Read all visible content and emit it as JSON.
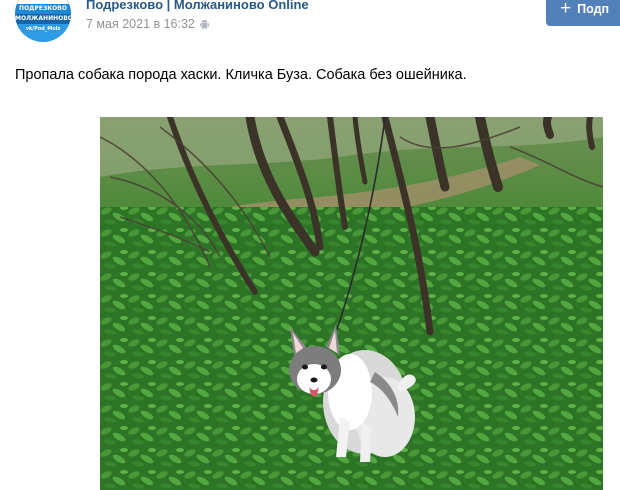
{
  "group": {
    "name": "Подрезково | Молжаниново Online",
    "avatar_lines": [
      "ПОДРЕЗКОВО",
      "МОЛЖАНИНОВО",
      "vk/Pod_Molz"
    ]
  },
  "post": {
    "date": "7 мая 2021 в 16:32",
    "platform_icon": "android-icon",
    "text": "Пропала собака порода хаски. Кличка Буза. Собака без ошейника."
  },
  "subscribe": {
    "label": "Подп",
    "icon": "plus-icon",
    "color": "#5181b8"
  },
  "colors": {
    "link": "#2a5885",
    "meta": "#939393",
    "foliage": "#2f7a2a"
  }
}
